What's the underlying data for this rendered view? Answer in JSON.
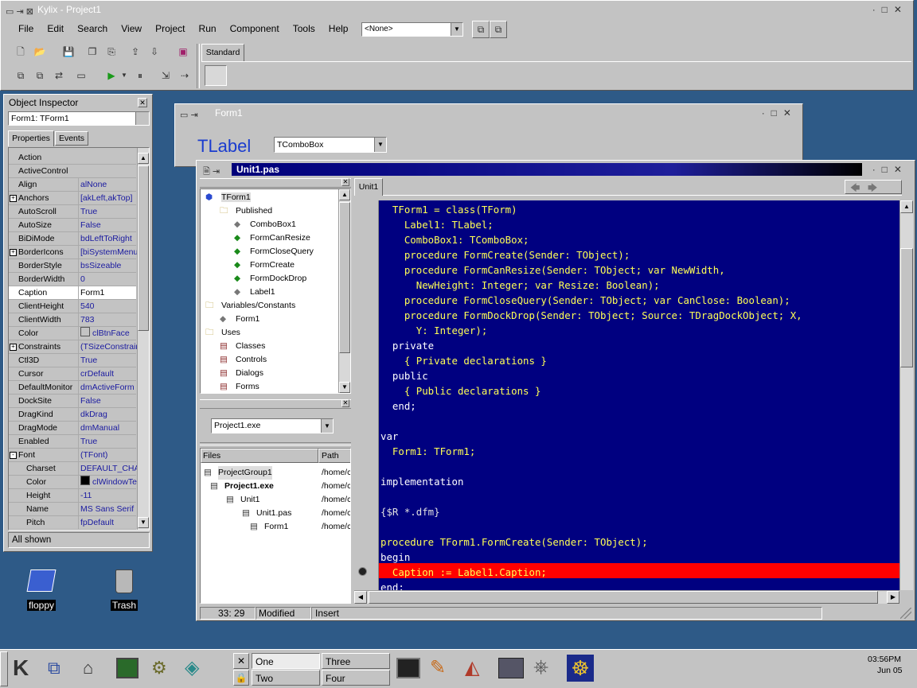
{
  "main_window": {
    "title": "Kylix - Project1",
    "menu": [
      "File",
      "Edit",
      "Search",
      "View",
      "Project",
      "Run",
      "Component",
      "Tools",
      "Help"
    ],
    "config_combo": "<None>",
    "palette_tab": "Standard"
  },
  "object_inspector": {
    "title": "Object Inspector",
    "selector": "Form1: TForm1",
    "tabs": [
      "Properties",
      "Events"
    ],
    "rows": [
      {
        "k": "Action",
        "v": "",
        "pm": ""
      },
      {
        "k": "ActiveControl",
        "v": "",
        "pm": ""
      },
      {
        "k": "Align",
        "v": "alNone",
        "pm": ""
      },
      {
        "k": "Anchors",
        "v": "[akLeft,akTop]",
        "pm": "+"
      },
      {
        "k": "AutoScroll",
        "v": "True",
        "pm": ""
      },
      {
        "k": "AutoSize",
        "v": "False",
        "pm": ""
      },
      {
        "k": "BiDiMode",
        "v": "bdLeftToRight",
        "pm": ""
      },
      {
        "k": "BorderIcons",
        "v": "[biSystemMenu,",
        "pm": "+"
      },
      {
        "k": "BorderStyle",
        "v": "bsSizeable",
        "pm": ""
      },
      {
        "k": "BorderWidth",
        "v": "0",
        "pm": ""
      },
      {
        "k": "Caption",
        "v": "Form1",
        "pm": ""
      },
      {
        "k": "ClientHeight",
        "v": "540",
        "pm": ""
      },
      {
        "k": "ClientWidth",
        "v": "783",
        "pm": ""
      },
      {
        "k": "Color",
        "v": "clBtnFace",
        "pm": ""
      },
      {
        "k": "Constraints",
        "v": "(TSizeConstrain",
        "pm": "+"
      },
      {
        "k": "Ctl3D",
        "v": "True",
        "pm": ""
      },
      {
        "k": "Cursor",
        "v": "crDefault",
        "pm": ""
      },
      {
        "k": "DefaultMonitor",
        "v": "dmActiveForm",
        "pm": ""
      },
      {
        "k": "DockSite",
        "v": "False",
        "pm": ""
      },
      {
        "k": "DragKind",
        "v": "dkDrag",
        "pm": ""
      },
      {
        "k": "DragMode",
        "v": "dmManual",
        "pm": ""
      },
      {
        "k": "Enabled",
        "v": "True",
        "pm": ""
      },
      {
        "k": "Font",
        "v": "(TFont)",
        "pm": "-"
      },
      {
        "k": "Charset",
        "v": "DEFAULT_CHA",
        "pm": ""
      },
      {
        "k": "Color",
        "v": "clWindowTex",
        "pm": ""
      },
      {
        "k": "Height",
        "v": "-11",
        "pm": ""
      },
      {
        "k": "Name",
        "v": "MS Sans Serif",
        "pm": ""
      },
      {
        "k": "Pitch",
        "v": "fpDefault",
        "pm": ""
      }
    ],
    "status": "All shown"
  },
  "form1": {
    "title": "Form1",
    "label_text": "TLabel",
    "combo_text": "TComboBox"
  },
  "unit_window": {
    "title": "Unit1.pas",
    "tab": "Unit1",
    "tree": [
      {
        "text": "TForm1",
        "indent": 0
      },
      {
        "text": "Published",
        "indent": 1
      },
      {
        "text": "ComboBox1",
        "indent": 2
      },
      {
        "text": "FormCanResize",
        "indent": 2
      },
      {
        "text": "FormCloseQuery",
        "indent": 2
      },
      {
        "text": "FormCreate",
        "indent": 2
      },
      {
        "text": "FormDockDrop",
        "indent": 2
      },
      {
        "text": "Label1",
        "indent": 2
      },
      {
        "text": "Variables/Constants",
        "indent": 0
      },
      {
        "text": "Form1",
        "indent": 1
      },
      {
        "text": "Uses",
        "indent": 0
      },
      {
        "text": "Classes",
        "indent": 1
      },
      {
        "text": "Controls",
        "indent": 1
      },
      {
        "text": "Dialogs",
        "indent": 1
      },
      {
        "text": "Forms",
        "indent": 1
      }
    ],
    "project_combo": "Project1.exe",
    "pm_headers": [
      "Files",
      "Path"
    ],
    "pm_rows": [
      {
        "name": "ProjectGroup1",
        "path": "/home/c"
      },
      {
        "name": "Project1.exe",
        "path": "/home/c"
      },
      {
        "name": "Unit1",
        "path": "/home/c"
      },
      {
        "name": "Unit1.pas",
        "path": "/home/c"
      },
      {
        "name": "Form1",
        "path": "/home/c"
      }
    ],
    "code_lines": [
      "  TForm1 = class(TForm)",
      "    Label1: TLabel;",
      "    ComboBox1: TComboBox;",
      "    procedure FormCreate(Sender: TObject);",
      "    procedure FormCanResize(Sender: TObject; var NewWidth,",
      "      NewHeight: Integer; var Resize: Boolean);",
      "    procedure FormCloseQuery(Sender: TObject; var CanClose: Boolean);",
      "    procedure FormDockDrop(Sender: TObject; Source: TDragDockObject; X,",
      "      Y: Integer);",
      "  private",
      "    { Private declarations }",
      "  public",
      "    { Public declarations }",
      "  end;",
      "",
      "var",
      "  Form1: TForm1;",
      "",
      "implementation",
      "",
      "{$R *.dfm}",
      "",
      "procedure TForm1.FormCreate(Sender: TObject);",
      "begin",
      "  Caption := Label1.Caption;",
      "end;"
    ],
    "status": {
      "pos": "33:  29",
      "modified": "Modified",
      "mode": "Insert"
    }
  },
  "desktop": {
    "icons": [
      "floppy",
      "Trash"
    ]
  },
  "taskbar": {
    "desktops": [
      "One",
      "Three",
      "Two",
      "Four"
    ],
    "time": "03:56PM",
    "date": "Jun 05"
  },
  "colors": {
    "editor_bg": "#000080",
    "code_fg": "#ffff55",
    "breakpoint": "#ff0000",
    "desktop": "#2e5a87"
  }
}
